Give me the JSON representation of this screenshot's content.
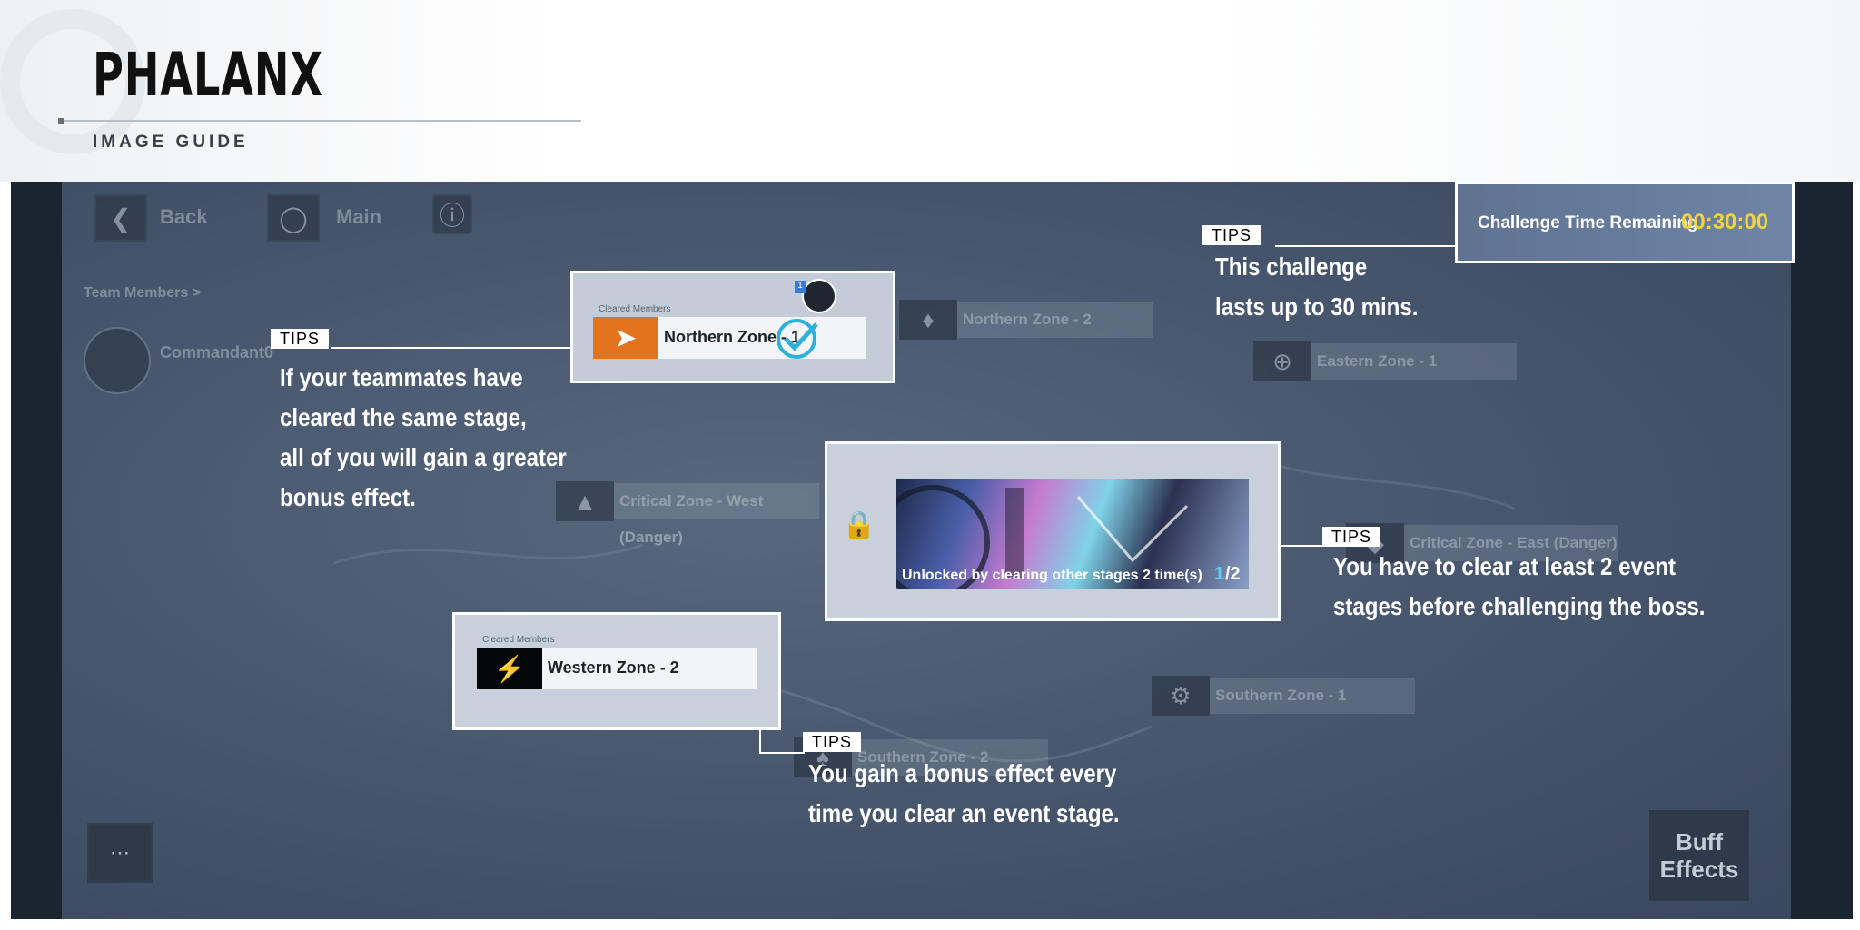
{
  "header": {
    "title": "PHALANX",
    "subtitle": "IMAGE GUIDE"
  },
  "game_ui": {
    "back_label": "Back",
    "main_label": "Main",
    "team_members_label": "Team Members >",
    "commander_name": "Commandant0",
    "member_badge": "1",
    "buff_effects_label": "Buff Effects"
  },
  "timer": {
    "label": "Challenge Time Remaining",
    "value": "00:30:00",
    "value_color": "#f2d33c"
  },
  "zones": {
    "northern_2": "Northern Zone - 2",
    "eastern_1": "Eastern Zone - 1",
    "critical_west": "Critical Zone - West (Danger)",
    "critical_east": "Critical Zone - East (Danger)",
    "southern_1": "Southern Zone - 1",
    "southern_2": "Southern Zone - 2"
  },
  "cards": {
    "northern_1": {
      "label": "Northern Zone - 1",
      "members_caption": "Cleared Members",
      "badge": "1"
    },
    "western_2": {
      "label": "Western Zone - 2",
      "members_caption": "Cleared Members"
    },
    "boss": {
      "unlock_text": "Unlocked by clearing other stages 2 time(s)",
      "progress_current": "1",
      "progress_total": "/2"
    }
  },
  "tips": {
    "tag": "TIPS",
    "timer_tip": [
      "This challenge",
      "lasts up to 30 mins."
    ],
    "team_tip": [
      "If your teammates have",
      "cleared the same stage,",
      "all of you will gain a greater",
      "bonus effect."
    ],
    "boss_tip": [
      "You have to clear at least 2 event",
      "stages before challenging the boss."
    ],
    "bonus_tip": [
      "You gain a bonus effect every",
      "time you clear an event stage."
    ]
  }
}
